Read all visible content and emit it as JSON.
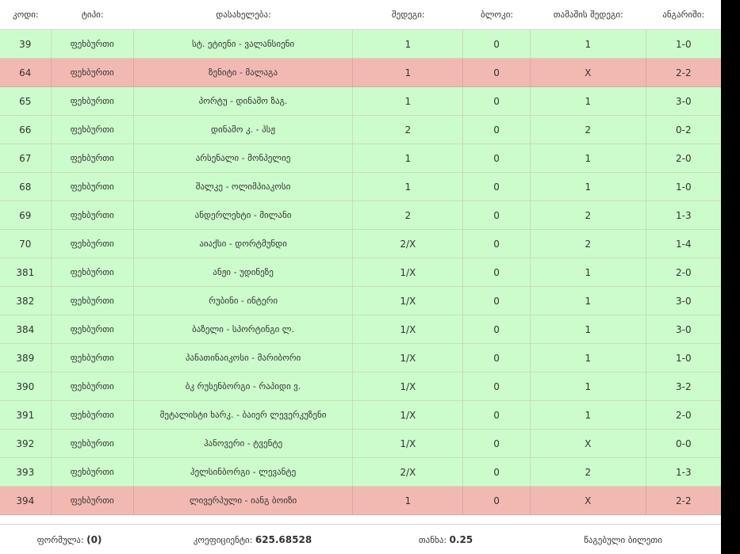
{
  "headers": {
    "code": "კოდი:",
    "type": "ტიპი:",
    "event": "დასახელება:",
    "outcome": "შედეგი:",
    "block": "ბლოკი:",
    "game_result": "თამაშის შედეგი:",
    "score": "ანგარიში:"
  },
  "rows": [
    {
      "code": "39",
      "type": "ფეხბურთი",
      "event": "სტ. ეტიენი - ვალანსიენი",
      "outcome": "1",
      "block": "0",
      "game_result": "1",
      "score": "1-0",
      "status": "won"
    },
    {
      "code": "64",
      "type": "ფეხბურთი",
      "event": "ზენიტი - მალაგა",
      "outcome": "1",
      "block": "0",
      "game_result": "X",
      "score": "2-2",
      "status": "lost"
    },
    {
      "code": "65",
      "type": "ფეხბურთი",
      "event": "პორტუ - დინამო ზაგ.",
      "outcome": "1",
      "block": "0",
      "game_result": "1",
      "score": "3-0",
      "status": "won"
    },
    {
      "code": "66",
      "type": "ფეხბურთი",
      "event": "დინამო კ. - პსჟ",
      "outcome": "2",
      "block": "0",
      "game_result": "2",
      "score": "0-2",
      "status": "won"
    },
    {
      "code": "67",
      "type": "ფეხბურთი",
      "event": "არსენალი - მონპელიე",
      "outcome": "1",
      "block": "0",
      "game_result": "1",
      "score": "2-0",
      "status": "won"
    },
    {
      "code": "68",
      "type": "ფეხბურთი",
      "event": "შალკე - ოლიმპიაკოსი",
      "outcome": "1",
      "block": "0",
      "game_result": "1",
      "score": "1-0",
      "status": "won"
    },
    {
      "code": "69",
      "type": "ფეხბურთი",
      "event": "ანდერლეხტი - მილანი",
      "outcome": "2",
      "block": "0",
      "game_result": "2",
      "score": "1-3",
      "status": "won"
    },
    {
      "code": "70",
      "type": "ფეხბურთი",
      "event": "აიაქსი - დორტმუნდი",
      "outcome": "2/X",
      "block": "0",
      "game_result": "2",
      "score": "1-4",
      "status": "won"
    },
    {
      "code": "381",
      "type": "ფეხბურთი",
      "event": "ანჟი - უდინეზე",
      "outcome": "1/X",
      "block": "0",
      "game_result": "1",
      "score": "2-0",
      "status": "won"
    },
    {
      "code": "382",
      "type": "ფეხბურთი",
      "event": "რუბინი - ინტერი",
      "outcome": "1/X",
      "block": "0",
      "game_result": "1",
      "score": "3-0",
      "status": "won"
    },
    {
      "code": "384",
      "type": "ფეხბურთი",
      "event": "ბაზელი - სპორტინგი ლ.",
      "outcome": "1/X",
      "block": "0",
      "game_result": "1",
      "score": "3-0",
      "status": "won"
    },
    {
      "code": "389",
      "type": "ფეხბურთი",
      "event": "პანათინაიკოსი - მარიბორი",
      "outcome": "1/X",
      "block": "0",
      "game_result": "1",
      "score": "1-0",
      "status": "won"
    },
    {
      "code": "390",
      "type": "ფეხბურთი",
      "event": "ბკ რუსენბორგი - რაპიდი ვ.",
      "outcome": "1/X",
      "block": "0",
      "game_result": "1",
      "score": "3-2",
      "status": "won"
    },
    {
      "code": "391",
      "type": "ფეხბურთი",
      "event": "მეტალისტი ხარკ. - ბაიერ ლევერკუზენი",
      "outcome": "1/X",
      "block": "0",
      "game_result": "1",
      "score": "2-0",
      "status": "won"
    },
    {
      "code": "392",
      "type": "ფეხბურთი",
      "event": "ჰანოვერი - ტვენტე",
      "outcome": "1/X",
      "block": "0",
      "game_result": "X",
      "score": "0-0",
      "status": "won"
    },
    {
      "code": "393",
      "type": "ფეხბურთი",
      "event": "ჰელსინბორგი - ლევანტე",
      "outcome": "2/X",
      "block": "0",
      "game_result": "2",
      "score": "1-3",
      "status": "won"
    },
    {
      "code": "394",
      "type": "ფეხბურთი",
      "event": "ლივერპული - იანგ ბოიზი",
      "outcome": "1",
      "block": "0",
      "game_result": "X",
      "score": "2-2",
      "status": "lost"
    }
  ],
  "footer": {
    "formula_label": "ფორმულა:",
    "formula_value": "(0)",
    "coef_label": "კოეფიციენტი:",
    "coef_value": "625.68528",
    "stake_label": "თანხა:",
    "stake_value": "0.25",
    "status_text": "წაგებული ბილეთი"
  },
  "colors": {
    "won_row": "#ccfccc",
    "lost_row": "#f2b9b3"
  }
}
